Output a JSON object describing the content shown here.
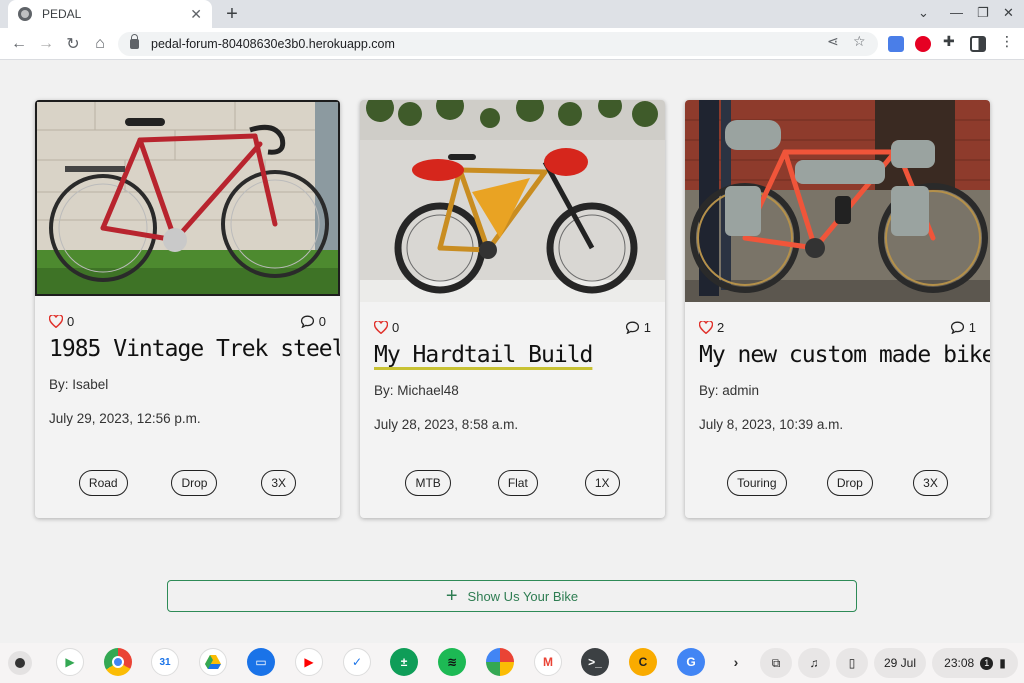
{
  "browser": {
    "tab_title": "PEDAL",
    "tab_close": "✕",
    "new_tab": "+",
    "url": "pedal-forum-80408630e3b0.herokuapp.com"
  },
  "posts": [
    {
      "likes": "0",
      "comments": "0",
      "title": "1985 Vintage Trek steel",
      "author": "By: Isabel",
      "date": "July 29, 2023, 12:56 p.m.",
      "tags": [
        "Road",
        "Drop",
        "3X"
      ]
    },
    {
      "likes": "0",
      "comments": "1",
      "title": "My Hardtail Build",
      "author": "By: Michael48",
      "date": "July 28, 2023, 8:58 a.m.",
      "tags": [
        "MTB",
        "Flat",
        "1X"
      ]
    },
    {
      "likes": "2",
      "comments": "1",
      "title": "My new custom made bike",
      "author": "By: admin",
      "date": "July 8, 2023, 10:39 a.m.",
      "tags": [
        "Touring",
        "Drop",
        "3X"
      ]
    }
  ],
  "show_button": {
    "label": "Show Us Your Bike",
    "icon": "plus-icon"
  },
  "shelf": {
    "date": "29 Jul",
    "time": "23:08",
    "notification_count": "1"
  },
  "colors": {
    "accent_green": "#2e8b57",
    "heart_red": "#e0312b",
    "title_underline": "#c8c233"
  }
}
